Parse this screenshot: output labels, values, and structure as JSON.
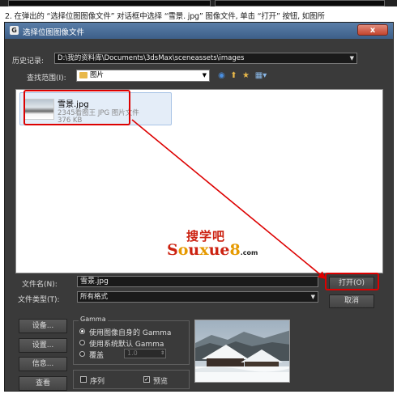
{
  "caption": "2. 在弹出的 “选择位图图像文件” 对话框中选择 “雪景. jpg” 图像文件, 单击 “打开” 按钮, 如图所",
  "dialog": {
    "title": "选择位图图像文件",
    "close_label": "x",
    "history_label": "历史记录:",
    "history_value": "D:\\我的资料库\\Documents\\3dsMax\\sceneassets\\images",
    "lookin_label": "查找范围(I):",
    "lookin_value": "图片",
    "file": {
      "name": "雪景.jpg",
      "desc": "2345看图王 JPG 图片文件",
      "size": "376 KB"
    },
    "watermark": {
      "line1": "搜学吧",
      "line2_a": "S",
      "line2_b": "o",
      "line2_c": "u",
      "line2_d": "x",
      "line2_e": "ue",
      "line2_f": "8",
      "line2_com": ".com"
    },
    "filename_label": "文件名(N):",
    "filename_value": "雪景.jpg",
    "filetype_label": "文件类型(T):",
    "filetype_value": "所有格式",
    "open_label": "打开(O)",
    "cancel_label": "取消",
    "buttons": {
      "setup": "设备...",
      "settings": "设置...",
      "info": "信息...",
      "view": "查看"
    },
    "gamma": {
      "title": "Gamma",
      "opt1": "使用图像自身的 Gamma",
      "opt2": "使用系统默认 Gamma",
      "opt3": "覆盖",
      "override_value": "1.0"
    },
    "sequence_label": "序列",
    "preview_label": "预览"
  }
}
